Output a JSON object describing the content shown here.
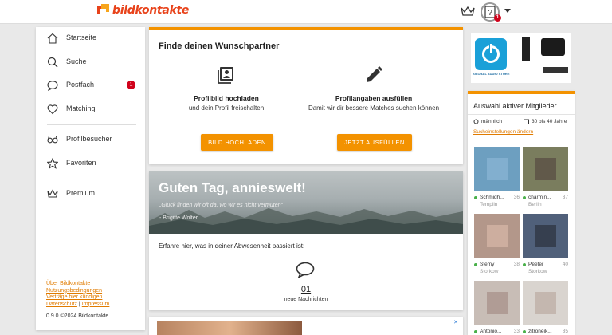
{
  "header": {
    "logo_text": "bildkontakte",
    "avatar_glyph": "?",
    "notification_count": "1"
  },
  "sidebar": {
    "items": [
      {
        "label": "Startseite",
        "icon": "home-icon"
      },
      {
        "label": "Suche",
        "icon": "search-icon"
      },
      {
        "label": "Postfach",
        "icon": "chat-icon",
        "badge": "1"
      },
      {
        "label": "Matching",
        "icon": "heart-icon"
      },
      {
        "label": "Profilbesucher",
        "icon": "glasses-icon"
      },
      {
        "label": "Favoriten",
        "icon": "star-icon"
      },
      {
        "label": "Premium",
        "icon": "crown-icon"
      }
    ],
    "footer_links": {
      "about": "Über Bildkontakte",
      "terms": "Nutzungsbedingungen",
      "cancel": "Verträge hier kündigen",
      "privacy": "Datenschutz",
      "separator": "|",
      "imprint": "Impressum"
    },
    "version": "0.9.0 ©2024 Bildkontakte"
  },
  "main": {
    "wish_card": {
      "title": "Finde deinen Wunschpartner",
      "photo_heading": "Profilbild hochladen",
      "photo_text": "und dein Profil freischalten",
      "photo_button": "BILD HOCHLADEN",
      "profile_heading": "Profilangaben ausfüllen",
      "profile_text": "Damit wir dir bessere Matches suchen können",
      "profile_button": "JETZT AUSFÜLLEN"
    },
    "welcome_card": {
      "greeting": "Guten Tag, annieswelt!",
      "quote": "„Glück finden wir oft da, wo wir es nicht vermuten“",
      "quote_author": "- Brigitte Wolter",
      "subtitle": "Erfahre hier, was in deiner Abwesenheit passiert ist:",
      "message_count": "01",
      "message_label": "neue Nachrichten"
    },
    "ad_close": "✕"
  },
  "right": {
    "ad_label": "GLOBAL AUDIO STORE",
    "members": {
      "title": "Auswahl aktiver Mitglieder",
      "gender": "männlich",
      "age_range": "30 bis 40 Jahre",
      "settings_link": "Sucheinstellungen ändern",
      "list": [
        {
          "name": "Schmidh...",
          "age": "36",
          "city": "Templin",
          "bg": "#6d9fc0"
        },
        {
          "name": "charmin...",
          "age": "37",
          "city": "Berlin",
          "bg": "#7a7d5e"
        },
        {
          "name": "Stemy",
          "age": "38",
          "city": "Storkow",
          "bg": "#b3978a"
        },
        {
          "name": "Peeter",
          "age": "40",
          "city": "Storkow",
          "bg": "#50607a"
        },
        {
          "name": "Antonio...",
          "age": "33",
          "city": "",
          "bg": "#c8bdb6"
        },
        {
          "name": "zitroneik...",
          "age": "35",
          "city": "",
          "bg": "#d9d4cf"
        }
      ]
    }
  }
}
